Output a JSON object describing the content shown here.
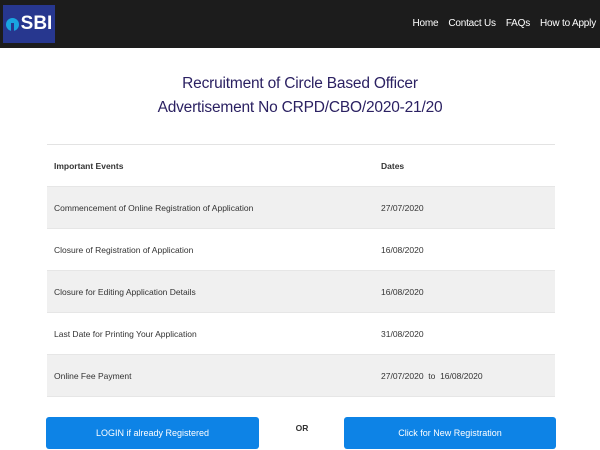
{
  "header": {
    "logo_text": "SBI",
    "brand_color": "#27378f",
    "logo_accent": "#19a5e0",
    "nav": [
      "Home",
      "Contact Us",
      "FAQs",
      "How to Apply"
    ]
  },
  "page": {
    "title_line1": "Recruitment of Circle Based Officer",
    "title_line2": "Advertisement No CRPD/CBO/2020-21/20"
  },
  "table": {
    "headers": [
      "Important Events",
      "Dates"
    ],
    "rows": [
      [
        "Commencement of Online Registration of Application",
        "27/07/2020"
      ],
      [
        "Closure of Registration of Application",
        "16/08/2020"
      ],
      [
        "Closure for Editing Application Details",
        "16/08/2020"
      ],
      [
        "Last Date for Printing Your Application",
        "31/08/2020"
      ],
      [
        "Online Fee Payment",
        "27/07/2020  to  16/08/2020"
      ]
    ]
  },
  "actions": {
    "login_label": "LOGIN if already Registered",
    "or_label": "OR",
    "new_registration_label": "Click for New Registration",
    "button_color": "#0d83e6"
  }
}
